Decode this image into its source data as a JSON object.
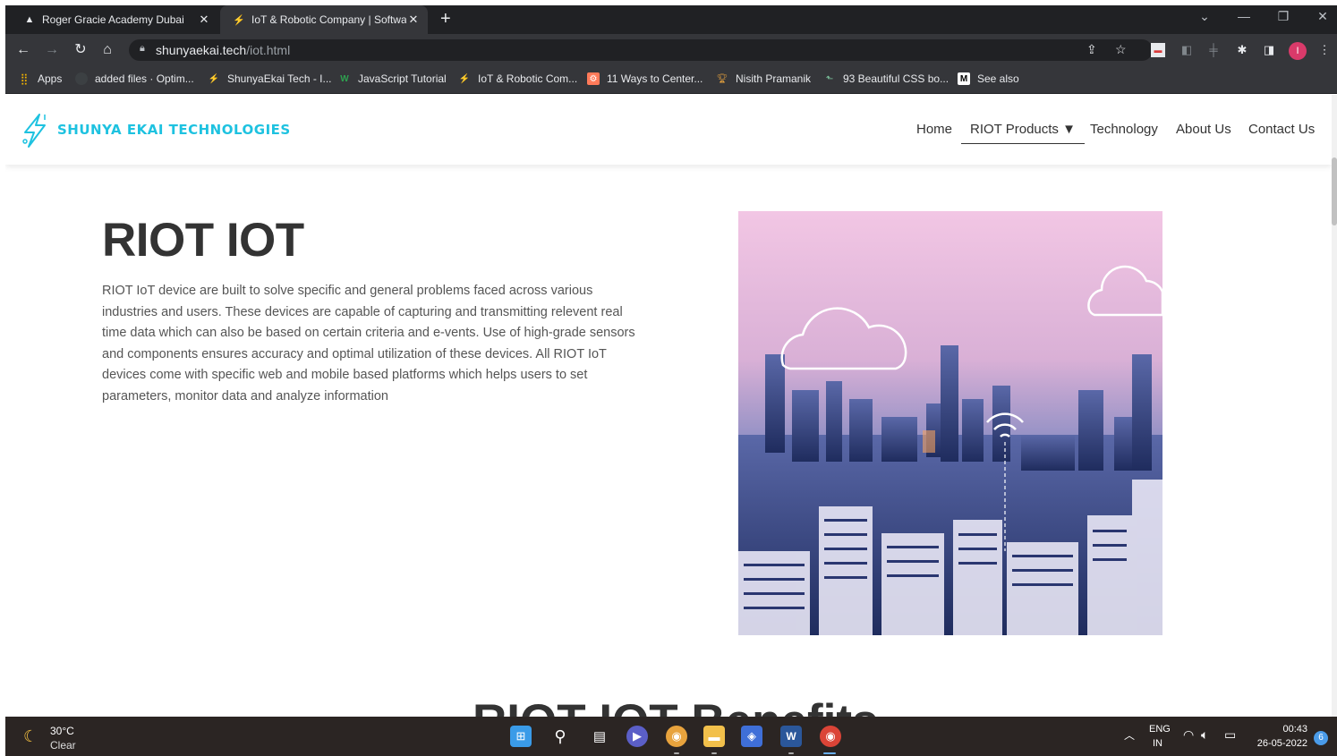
{
  "browser": {
    "tabs": [
      {
        "title": "Roger Gracie Academy Dubai",
        "active": false
      },
      {
        "title": "IoT & Robotic Company | Softwa",
        "active": true
      }
    ],
    "url_host": "shunyaekai.tech",
    "url_path": "/iot.html",
    "bookmarks": [
      "Apps",
      "added files · Optim...",
      "ShunyaEkai Tech - I...",
      "JavaScript Tutorial",
      "IoT & Robotic Com...",
      "11 Ways to Center...",
      "Nisith Pramanik",
      "93 Beautiful CSS bo...",
      "See also"
    ],
    "profile_initial": "I"
  },
  "site": {
    "brand": "SHUNYA EKAI TECHNOLOGIES",
    "nav": {
      "home": "Home",
      "products": "RIOT Products ▼",
      "technology": "Technology",
      "about": "About Us",
      "contact": "Contact Us"
    },
    "hero": {
      "title": "RIOT IOT",
      "text": "RIOT IoT device are built to solve specific and general problems faced across various industries and users. These devices are capable of capturing and transmitting relevent real time data which can also be based on certain criteria and e-vents. Use of high-grade sensors and components ensures accuracy and optimal utilization of these devices. All RIOT IoT devices come with specific web and mobile based platforms which helps users to set parameters, monitor data and analyze information"
    },
    "section2_title": "RIOT IOT Benefits"
  },
  "taskbar": {
    "temperature": "30°C",
    "condition": "Clear",
    "lang_line1": "ENG",
    "lang_line2": "IN",
    "time": "00:43",
    "date": "26-05-2022",
    "notifications": "6"
  },
  "colors": {
    "brand": "#1ec2e0",
    "chrome_dark": "#202124",
    "chrome_toolbar": "#35363a"
  }
}
